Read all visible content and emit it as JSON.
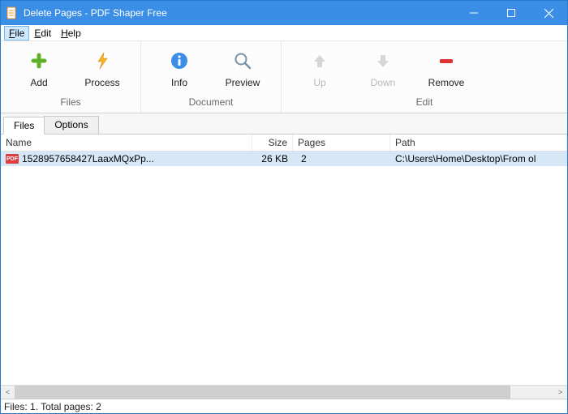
{
  "window": {
    "title": "Delete Pages - PDF Shaper Free"
  },
  "menu": {
    "file": "File",
    "edit": "Edit",
    "help": "Help"
  },
  "toolbar": {
    "add": "Add",
    "process": "Process",
    "info": "Info",
    "preview": "Preview",
    "up": "Up",
    "down": "Down",
    "remove": "Remove",
    "group_files": "Files",
    "group_document": "Document",
    "group_edit": "Edit"
  },
  "tabs": {
    "files": "Files",
    "options": "Options"
  },
  "columns": {
    "name": "Name",
    "size": "Size",
    "pages": "Pages",
    "path": "Path"
  },
  "rows": [
    {
      "icon": "PDF",
      "name": "1528957658427LaaxMQxPp...",
      "size": "26 KB",
      "pages": "2",
      "path": "C:\\Users\\Home\\Desktop\\From ol"
    }
  ],
  "status": "Files: 1. Total pages: 2"
}
